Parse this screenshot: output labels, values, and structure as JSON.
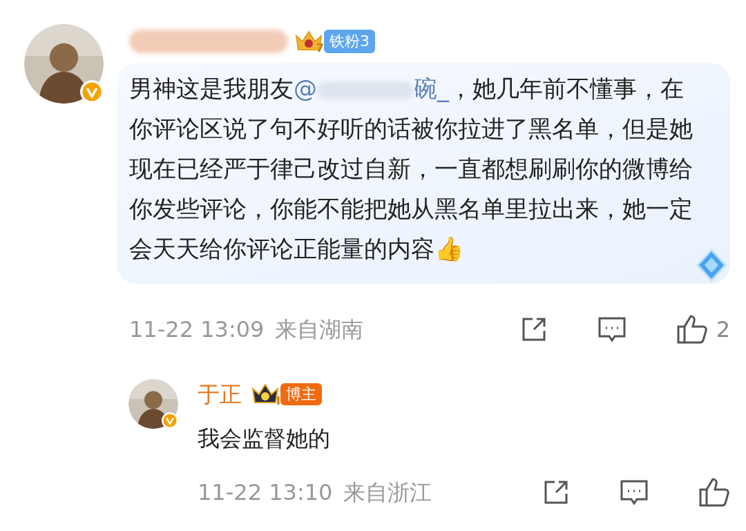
{
  "comment": {
    "author_badge": {
      "level": "7",
      "label": "铁粉3"
    },
    "text_before": "男神这是我朋友",
    "mention": "@",
    "mention_tail": "碗_",
    "text_after": "，她几年前不懂事，在你评论区说了句不好听的话被你拉进了黑名单，但是她现在已经严于律己改过自新，一直都想刷刷你的微博给你发些评论，你能不能把她从黑名单里拉出来，她一定会天天给你评论正能量的内容👍",
    "time": "11-22 13:09",
    "location": "来自湖南",
    "likes": "2"
  },
  "reply": {
    "author": "于正",
    "badge_level": "I",
    "badge_label": "博主",
    "text": "我会监督她的",
    "time": "11-22 13:10",
    "location": "来自浙江"
  }
}
